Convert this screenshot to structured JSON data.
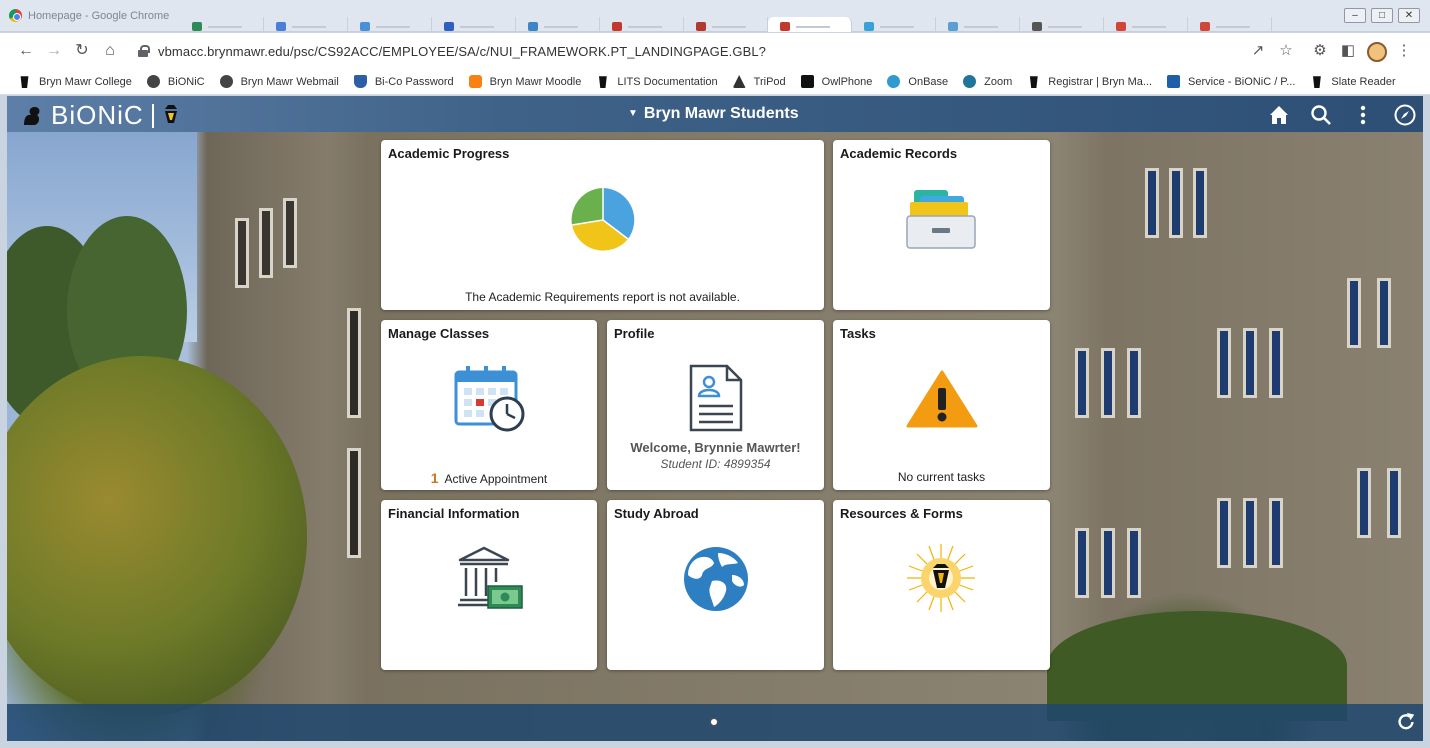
{
  "browser": {
    "window_title": "Homepage - Google Chrome",
    "url": "vbmacc.brynmawr.edu/psc/CS92ACC/EMPLOYEE/SA/c/NUI_FRAMEWORK.PT_LANDINGPAGE.GBL?",
    "window_controls": [
      "–",
      "□",
      "✕"
    ],
    "tabs": [
      {
        "fav_color": "#2e8b57",
        "active": false
      },
      {
        "fav_color": "#4a7fd8",
        "active": false
      },
      {
        "fav_color": "#4a90d9",
        "active": false
      },
      {
        "fav_color": "#2f5fbf",
        "active": false
      },
      {
        "fav_color": "#3d85c6",
        "active": false
      },
      {
        "fav_color": "#c0392b",
        "active": false
      },
      {
        "fav_color": "#b03a2e",
        "active": false
      },
      {
        "fav_color": "#c0392b",
        "active": true
      },
      {
        "fav_color": "#3aa0d8",
        "active": false
      },
      {
        "fav_color": "#5a9fd4",
        "active": false
      },
      {
        "fav_color": "#555555",
        "active": false
      },
      {
        "fav_color": "#d0473a",
        "active": false
      },
      {
        "fav_color": "#d0473a",
        "active": false
      }
    ],
    "bookmarks": [
      {
        "label": "Bryn Mawr College",
        "icon": "lantern-icon"
      },
      {
        "label": "BiONiC",
        "icon": "globe-icon"
      },
      {
        "label": "Bryn Mawr Webmail",
        "icon": "globe-icon"
      },
      {
        "label": "Bi-Co Password",
        "icon": "shield-icon"
      },
      {
        "label": "Bryn Mawr Moodle",
        "icon": "moodle-icon"
      },
      {
        "label": "LITS Documentation",
        "icon": "lantern-icon"
      },
      {
        "label": "TriPod",
        "icon": "tripod-icon"
      },
      {
        "label": "OwlPhone",
        "icon": "owlphone-icon"
      },
      {
        "label": "OnBase",
        "icon": "onbase-icon"
      },
      {
        "label": "Zoom",
        "icon": "wordpress-icon"
      },
      {
        "label": "Registrar | Bryn Ma...",
        "icon": "lantern-icon"
      },
      {
        "label": "Service - BiONiC / P...",
        "icon": "td-icon"
      },
      {
        "label": "Slate Reader",
        "icon": "lantern-icon"
      }
    ]
  },
  "header": {
    "logo_text": "BiONiC",
    "homepage_selector": "Bryn Mawr Students"
  },
  "tiles": {
    "academic_progress": {
      "title": "Academic Progress",
      "footer": "The Academic Requirements report is not available."
    },
    "academic_records": {
      "title": "Academic Records"
    },
    "manage_classes": {
      "title": "Manage Classes",
      "count": "1",
      "footer": "Active Appointment"
    },
    "profile": {
      "title": "Profile",
      "welcome": "Welcome, Brynnie Mawrter!",
      "student_id": "Student ID: 4899354"
    },
    "tasks": {
      "title": "Tasks",
      "footer": "No current tasks"
    },
    "financial_information": {
      "title": "Financial Information"
    },
    "study_abroad": {
      "title": "Study Abroad"
    },
    "resources_forms": {
      "title": "Resources & Forms"
    }
  },
  "colors": {
    "topbar": "#3f6288",
    "pie_blue": "#4aa3df",
    "pie_yellow": "#f0c419",
    "pie_green": "#6ab04c",
    "warning_orange": "#f39c12",
    "count_orange": "#c8791a"
  }
}
